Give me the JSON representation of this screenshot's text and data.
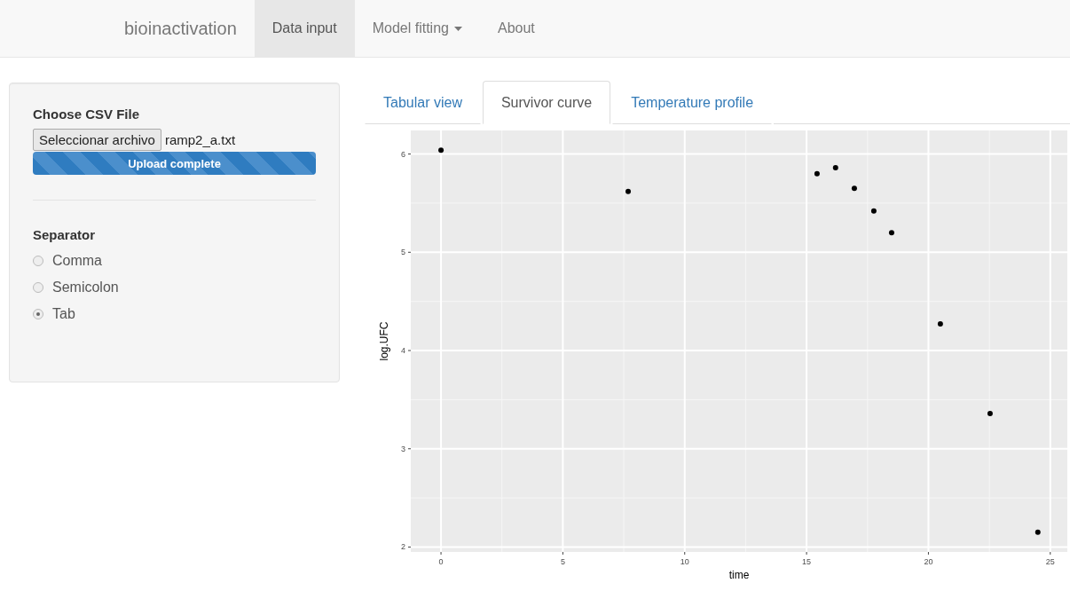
{
  "navbar": {
    "brand": "bioinactivation",
    "items": [
      {
        "label": "Data input",
        "selected": true,
        "kind": "link"
      },
      {
        "label": "Model fitting",
        "selected": false,
        "kind": "dropdown"
      },
      {
        "label": "About",
        "selected": false,
        "kind": "link"
      }
    ]
  },
  "sidebar": {
    "file_label": "Choose CSV File",
    "file_button": "Seleccionar archivo",
    "file_name": "ramp2_a.txt",
    "progress": {
      "label": "Upload complete",
      "level": 1
    },
    "separator_label": "Separator",
    "options": [
      {
        "label": "Comma",
        "selected": false
      },
      {
        "label": "Semicolon",
        "selected": false
      },
      {
        "label": "Tab",
        "selected": true
      }
    ]
  },
  "tabs": [
    {
      "label": "Tabular view",
      "selected": false
    },
    {
      "label": "Survivor curve",
      "selected": true
    },
    {
      "label": "Temperature profile",
      "selected": false
    }
  ],
  "plot": {
    "chart_data": {
      "type": "scatter",
      "xlabel": "time",
      "ylabel": "log.UFC",
      "grid": true,
      "xlim": [
        -1.24,
        25.7
      ],
      "ylim": [
        1.95,
        6.24
      ],
      "xticks": [
        0,
        5,
        10,
        15,
        20,
        25
      ],
      "yticks": [
        2,
        3,
        4,
        5,
        6
      ],
      "series": [
        {
          "color": "#000000",
          "x": [
            0,
            7.68,
            15.43,
            16.19,
            16.96,
            17.76,
            18.49,
            20.49,
            22.53,
            24.49
          ],
          "values": [
            6.04,
            5.62,
            5.8,
            5.86,
            5.65,
            5.42,
            5.2,
            4.27,
            3.36,
            2.15
          ]
        }
      ]
    }
  }
}
